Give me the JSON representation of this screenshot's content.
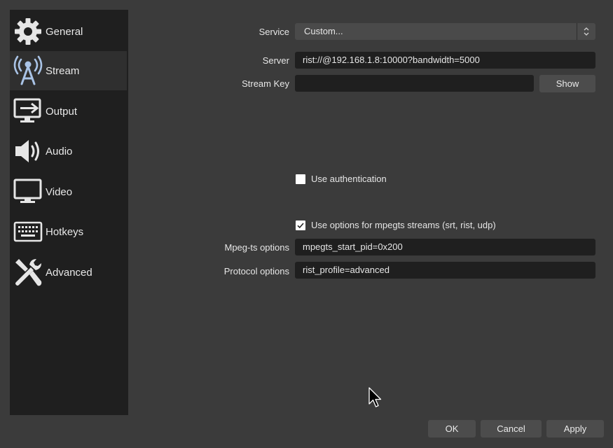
{
  "sidebar": {
    "items": [
      {
        "label": "General",
        "icon": "gear-icon"
      },
      {
        "label": "Stream",
        "icon": "antenna-icon"
      },
      {
        "label": "Output",
        "icon": "output-monitor-icon"
      },
      {
        "label": "Audio",
        "icon": "speaker-icon"
      },
      {
        "label": "Video",
        "icon": "monitor-icon"
      },
      {
        "label": "Hotkeys",
        "icon": "keyboard-icon"
      },
      {
        "label": "Advanced",
        "icon": "tools-icon"
      }
    ],
    "active": "Stream"
  },
  "stream": {
    "service_label": "Service",
    "service_value": "Custom...",
    "server_label": "Server",
    "server_value": "rist://@192.168.1.8:10000?bandwidth=5000",
    "stream_key_label": "Stream Key",
    "stream_key_value": "",
    "show_button": "Show",
    "use_auth_label": "Use authentication",
    "use_auth_checked": false,
    "mpegts_options_check_label": "Use options for mpegts streams (srt, rist, udp)",
    "mpegts_options_checked": true,
    "mpegts_label": "Mpeg-ts options",
    "mpegts_value": "mpegts_start_pid=0x200",
    "protocol_label": "Protocol options",
    "protocol_value": "rist_profile=advanced"
  },
  "footer": {
    "ok": "OK",
    "cancel": "Cancel",
    "apply": "Apply"
  },
  "colors": {
    "background": "#3b3b3b",
    "sidebar": "#1f1f1f",
    "active_item": "#2f2f2f",
    "field": "#1f1f1f",
    "button": "#4c4c4c",
    "icon_white": "#e6e6e6",
    "icon_blue": "#a9c3e6"
  }
}
